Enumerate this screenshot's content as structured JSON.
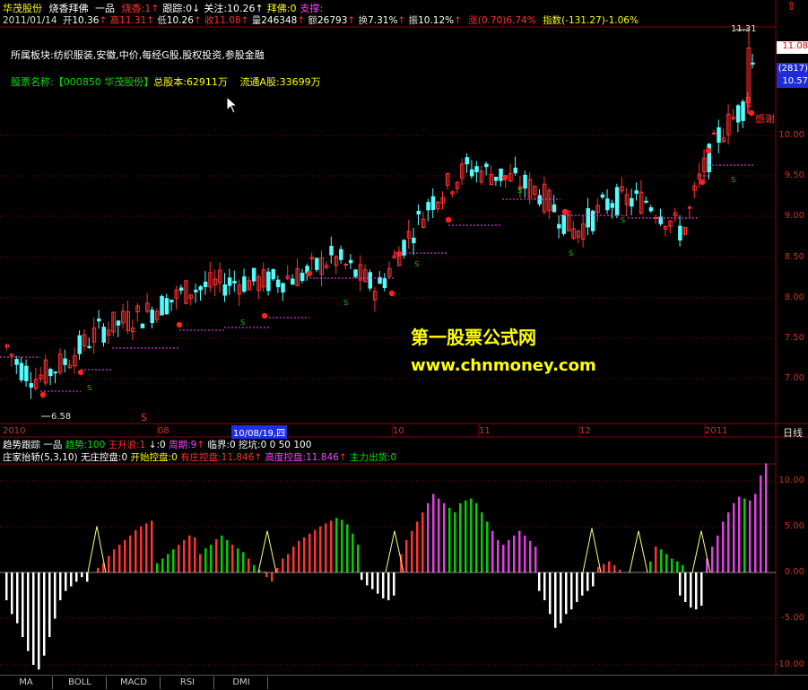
{
  "header": {
    "stock_name": "华茂股份",
    "indicator_name": "烧香拜佛",
    "grade": "一品",
    "fields": [
      {
        "label": "烧香:",
        "value": "1",
        "arrow": "↑",
        "color": "#ff3030"
      },
      {
        "label": "跟踪:",
        "value": "0",
        "arrow": "↓",
        "color": "#ffffff"
      },
      {
        "label": "关注:",
        "value": "10.26",
        "arrow": "↑",
        "color": "#ffffff"
      },
      {
        "label": "拜佛:",
        "value": "0",
        "arrow": "",
        "color": "#ffff00"
      },
      {
        "label": "支撑:",
        "value": "",
        "arrow": "",
        "color": "#ff40ff"
      }
    ],
    "top_right_icon": "⇧"
  },
  "quote": {
    "date": "2011/01/14",
    "open_label": "开",
    "open": "10.36",
    "high_label": "高",
    "high": "11.31",
    "low_label": "低",
    "low": "10.26",
    "close_label": "收",
    "close": "11.08",
    "vol_label": "量",
    "vol": "246348",
    "amt_label": "额",
    "amt": "26793",
    "turn_label": "换",
    "turn": "7.31%",
    "amp_label": "振",
    "amp": "10.12%",
    "chg_label": "涨",
    "chg": "(0.70)6.74%",
    "idx_label": "指数",
    "idx": "(-131.27)-1.06%"
  },
  "info": {
    "sector_label": "所属板块:",
    "sector_value": "纺织服装,安徽,中价,每经G股,股权投资,参股金融",
    "name_label": "股票名称:",
    "name_value": "【000850 华茂股份】",
    "shares_label": "总股本:",
    "shares_value": "62911万",
    "float_label": "流通A股:",
    "float_value": "33699万"
  },
  "watermark": {
    "line1": "第一股票公式网",
    "line2": "www.chnmoney.com"
  },
  "price_axis": {
    "ticks": [
      "10.00",
      "9.50",
      "9.00",
      "8.50",
      "8.00",
      "7.50",
      "7.00"
    ],
    "box_top": "11.08",
    "box_mid": "(2817)",
    "box_low": "10.57",
    "high_label": "11.31",
    "low_label": "6.58",
    "buy_signal": "S",
    "side_label": "感谢"
  },
  "date_axis": {
    "labels": [
      "2010",
      "08",
      "10",
      "11",
      "12",
      "2011"
    ],
    "cursor_label": "10/08/19,四",
    "period": "日线"
  },
  "indicator_bar1": {
    "name": "趋势跟踪",
    "grade": "一品",
    "trend_label": "趋势:",
    "trend": "100",
    "wave_label": "王升浪:",
    "wave": "1",
    "down": "↓:0",
    "cycle_label": "周期:",
    "cycle": "9",
    "crit_label": "临界:",
    "crit": "0",
    "dig_label": "挖坑:",
    "dig": "0 0 50 100"
  },
  "indicator_bar2": {
    "name": "庄家抬轿(5,3,10)",
    "f1_label": "无庄控盘:",
    "f1": "0",
    "f2_label": "开始控盘:",
    "f2": "0",
    "f3_label": "有庄控盘:",
    "f3": "11.846",
    "f4_label": "高度控盘:",
    "f4": "11.846",
    "f5_label": "主力出货:",
    "f5": "0"
  },
  "sub_axis": {
    "ticks": [
      "10.00",
      "5.00",
      "0.00",
      "-5.00",
      "-10.00"
    ]
  },
  "tabs": [
    "MA",
    "BOLL",
    "MACD",
    "RSI",
    "DMI"
  ],
  "colors": {
    "up": "#ff3232",
    "down": "#54fcfc",
    "green": "#00d000",
    "magenta": "#e040e0",
    "white": "#ffffff",
    "yellow": "#ffff00",
    "grid": "#8b0000"
  }
}
